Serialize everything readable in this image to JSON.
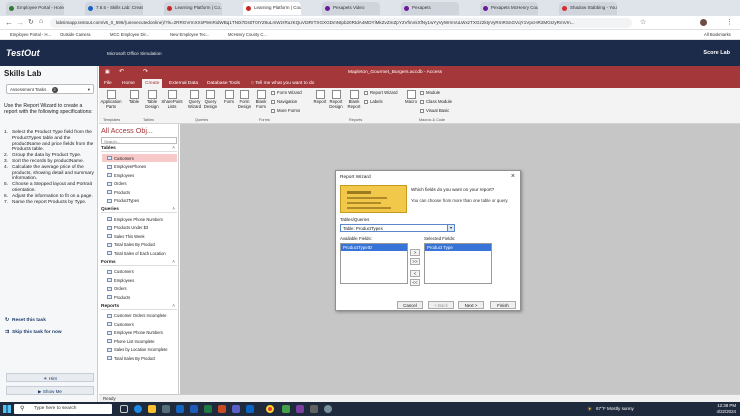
{
  "browser": {
    "tabs": [
      {
        "label": "Employee Portal - Home",
        "color": "#2e7d32",
        "active": false
      },
      {
        "label": "7.6.5 - Skills Lab: Create",
        "color": "#1565c0",
        "active": false
      },
      {
        "label": "Learning Platform | Co...",
        "color": "#c62828",
        "active": false
      },
      {
        "label": "Learning Platform | Cou...",
        "color": "#c62828",
        "active": true
      },
      {
        "label": "Pexapets Video",
        "color": "#6a1b9a",
        "active": false
      },
      {
        "label": "Pexapets",
        "color": "#6a1b9a",
        "active": false
      },
      {
        "label": "Pexapets McHenry County...",
        "color": "#6a1b9a",
        "active": false
      },
      {
        "label": "Shadow Stabbing - YouTu...",
        "color": "#d32f2f",
        "active": false
      }
    ],
    "url": "labsimapp.testout.com/v6_0_596/(unexecutedonline)/?ls=2RRGVrmXXsP9mRidWBq1TN0i7Ds0T0IYZ6uLmWzrRuzKQuVt3RrTXGXGDmNtpb20RtdA4MDYlMkZvZmZpY2VfmmiXfNy1wYyVyWrmVuLWxzTXGz2ktyVyRmRSnGVqY1VpcHR2MGIzyRmVIn...",
    "bookmarks": [
      "Employee Portal - H...",
      "Outside Camera",
      "MCC Employee Dir...",
      "New Employee Tec...",
      "McHenry County C..."
    ],
    "all_bookmarks": "All Bookmarks"
  },
  "testout": {
    "logo": "TestOut",
    "app_label": "Microsoft Office Simulation",
    "score_lab": "Score Lab"
  },
  "skills": {
    "title": "Skills Lab",
    "assessment": "Assessment Tasks",
    "assessment_count": "2",
    "intro": "Use the Report Wizard to create a report with the following specifications:",
    "steps": [
      {
        "n": "1.",
        "text": "Select the Product Type field from the ProductTypes table and the productName and price fields from the Products table."
      },
      {
        "n": "2.",
        "text": "Group the data by Product Type."
      },
      {
        "n": "3.",
        "text": "Sort the records by productName."
      },
      {
        "n": "4.",
        "text": "Calculate the average price of the products, showing detail and summary information."
      },
      {
        "n": "5.",
        "text": "Choose a Stepped layout and Portrait orientation."
      },
      {
        "n": "6.",
        "text": "Adjust the information to fit on a page."
      },
      {
        "n": "7.",
        "text": "Name the report Products by Type."
      }
    ],
    "reset": "Reset this task",
    "skip": "Skip this task for now",
    "hint": "Hint",
    "show_me": "Show Me"
  },
  "access": {
    "title": "Mapleton_Gourmet_Burgers.accdb - Access",
    "menu": [
      "File",
      "Home",
      "Create",
      "External Data",
      "Database Tools",
      "Tell me what you want to do"
    ],
    "ribbon": {
      "app_parts": "Application Parts",
      "table": "Table",
      "table_design": "Table Design",
      "sharepoint": "SharePoint Lists",
      "query_wizard": "Query Wizard",
      "query_design": "Query Design",
      "form": "Form",
      "form_design": "Form Design",
      "blank_form": "Blank Form",
      "form_wizard": "Form Wizard",
      "navigation": "Navigation",
      "more_forms": "More Forms",
      "report": "Report",
      "report_design": "Report Design",
      "blank_report": "Blank Report",
      "report_wizard": "Report Wizard",
      "labels": "Labels",
      "macro": "Macro",
      "module": "Module",
      "class_module": "Class Module",
      "visual_basic": "Visual Basic",
      "groups": [
        "Templates",
        "Tables",
        "Queries",
        "Forms",
        "Reports",
        "Macros & Code"
      ]
    },
    "nav": {
      "title": "All Access Obj...",
      "search": "Search...",
      "sections": [
        {
          "name": "Tables",
          "items": [
            "Customers",
            "EmployeePhones",
            "Employees",
            "Orders",
            "Products",
            "ProductTypes"
          ]
        },
        {
          "name": "Queries",
          "items": [
            "Employee Phone Numbers",
            "Products Under $3",
            "Sales This Week",
            "Total Sales By Product",
            "Total Sales of Each Location"
          ]
        },
        {
          "name": "Forms",
          "items": [
            "Customers",
            "Employees",
            "Orders",
            "Products"
          ]
        },
        {
          "name": "Reports",
          "items": [
            "Customer Orders Incomplete",
            "Customers",
            "Employee Phone Numbers",
            "Phone List Incomplete",
            "Sales by Location Incomplete",
            "Total Sales By Product"
          ]
        }
      ]
    },
    "status": "Ready"
  },
  "dialog": {
    "title": "Report Wizard",
    "question": "Which fields do you want on your report?",
    "note": "You can choose from more than one table or query.",
    "tables_label": "Tables/Queries",
    "tables_value": "Table: ProductTypes",
    "available_label": "Available Fields:",
    "selected_label": "Selected Fields:",
    "available": [
      "ProductTypeID"
    ],
    "selected": [
      "Product Type"
    ],
    "arrows": [
      ">",
      ">>",
      "<",
      "<<"
    ],
    "cancel": "Cancel",
    "back": "< Back",
    "next": "Next >",
    "finish": "Finish"
  },
  "taskbar": {
    "search": "Type here to search",
    "weather": "67°F  Mostly sunny",
    "time": "12:38 PM",
    "date": "4/22/2024"
  }
}
